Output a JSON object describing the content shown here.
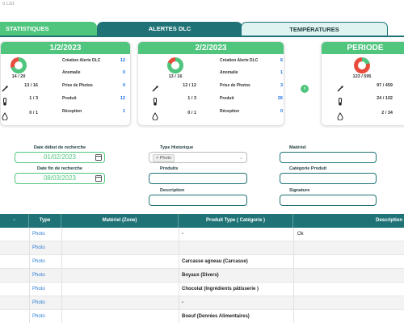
{
  "app": {
    "title": "o List"
  },
  "tabs": [
    {
      "label": "STATISTIQUES"
    },
    {
      "label": "ALERTES DLC"
    },
    {
      "label": "TEMPÉRATURES"
    }
  ],
  "cards": [
    {
      "title": "1/2/2023",
      "donut_ratio": "14 / 20",
      "icon_rows": [
        {
          "icon": "thermometer-probe-icon",
          "value": "13 / 16"
        },
        {
          "icon": "thermometer-icon",
          "value": "1 / 3"
        },
        {
          "icon": "drop-icon",
          "value": "0 / 1"
        }
      ],
      "stats": [
        {
          "label": "Création Alerte DLC",
          "value": "12"
        },
        {
          "label": "Anomalie",
          "value": "0"
        },
        {
          "label": "Prise de Photos",
          "value": "0"
        },
        {
          "label": "Produit",
          "value": "12"
        },
        {
          "label": "Réception",
          "value": "1"
        }
      ]
    },
    {
      "title": "2/2/2023",
      "donut_ratio": "13 / 16",
      "icon_rows": [
        {
          "icon": "thermometer-probe-icon",
          "value": "12 / 12"
        },
        {
          "icon": "thermometer-icon",
          "value": "1 / 3"
        },
        {
          "icon": "drop-icon",
          "value": "0 / 1"
        }
      ],
      "stats": [
        {
          "label": "Création Alerte DLC",
          "value": "6"
        },
        {
          "label": "Anomalie",
          "value": "1"
        },
        {
          "label": "Prise de Photos",
          "value": "3"
        },
        {
          "label": "Produit",
          "value": "26"
        },
        {
          "label": "Réception",
          "value": "0"
        }
      ]
    },
    {
      "title": "PERIODE",
      "donut_ratio": "123 / 595",
      "icon_rows": [
        {
          "icon": "thermometer-probe-icon",
          "value": "97 / 459"
        },
        {
          "icon": "thermometer-icon",
          "value": "24 / 102"
        },
        {
          "icon": "drop-icon",
          "value": "2 / 34"
        }
      ],
      "stats": []
    }
  ],
  "filters": {
    "date_start_label": "Date début de recherche",
    "date_start_value": "01/02/2023",
    "date_end_label": "Date fin de recherche",
    "date_end_value": "08/03/2023",
    "type_label": "Type Historique",
    "type_selected": "× Photo",
    "produits_label": "Produits",
    "description_label": "Description",
    "materiel_label": "Matériel",
    "categorie_label": "Catégorie Produit",
    "signature_label": "Signature"
  },
  "table": {
    "headers": [
      "Type",
      "Matériel (Zone)",
      "Produit Type ( Catégorie )",
      "Description"
    ],
    "rows": [
      {
        "type": "Photo",
        "produit": "-",
        "description": "Ok"
      },
      {
        "type": "Photo",
        "produit": "",
        "description": ""
      },
      {
        "type": "Photo",
        "produit": "Carcasse agneau (Carcasse)",
        "description": ""
      },
      {
        "type": "Photo",
        "produit": "Boyaux (Divers)",
        "description": ""
      },
      {
        "type": "Photo",
        "produit": "Chocolat (Ingrédients pâtisserie )",
        "description": ""
      },
      {
        "type": "Photo",
        "produit": "-",
        "description": ""
      },
      {
        "type": "Photo",
        "produit": "Boeuf (Denrées Alimentaires)",
        "description": ""
      }
    ]
  },
  "colors": {
    "green": "#4fc57e",
    "teal": "#1f7377",
    "red": "#e74c3c",
    "link": "#2d7bd1"
  },
  "donut_fractions": [
    0.7,
    0.8125,
    0.2067
  ]
}
